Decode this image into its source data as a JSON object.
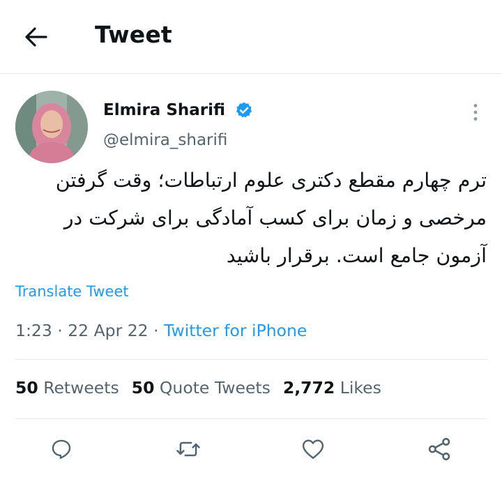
{
  "header": {
    "title": "Tweet"
  },
  "author": {
    "name": "Elmira Sharifi",
    "handle": "@elmira_sharifi"
  },
  "tweet": {
    "text": "ترم چهارم مقطع دکتری علوم ارتباطات؛ وقت گرفتن مرخصی و زمان برای کسب آمادگی برای شرکت در آزمون جامع است. برقرار باشید",
    "translate_label": "Translate Tweet"
  },
  "meta": {
    "time": "1:23",
    "sep1": " · ",
    "date": "22 Apr 22",
    "sep2": " · ",
    "source": "Twitter for iPhone"
  },
  "stats": {
    "retweets_count": "50",
    "retweets_label": "Retweets",
    "quotes_count": "50",
    "quotes_label": "Quote Tweets",
    "likes_count": "2,772",
    "likes_label": "Likes"
  },
  "icons": {
    "back": "arrow-left-icon",
    "verified": "verified-badge-icon",
    "more": "vertical-dots-icon",
    "reply": "reply-icon",
    "retweet": "retweet-icon",
    "like": "heart-icon",
    "share": "share-icon"
  },
  "colors": {
    "accent": "#1d9bf0",
    "text": "#0f1419",
    "secondary": "#536471",
    "divider": "#e6e9ec"
  }
}
